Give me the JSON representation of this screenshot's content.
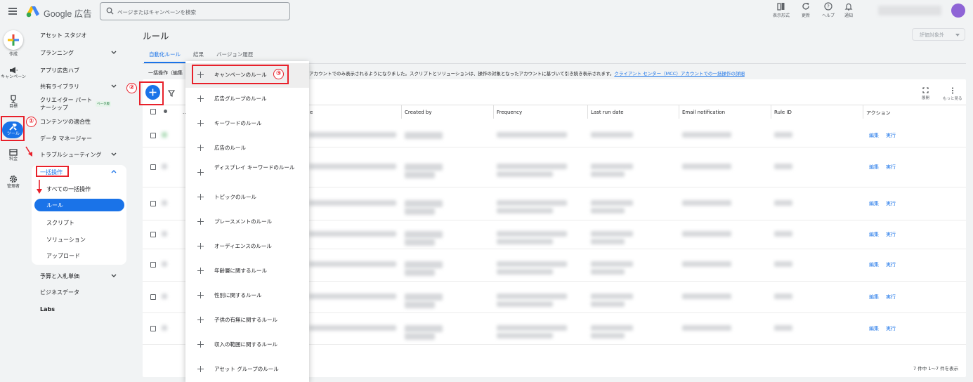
{
  "header": {
    "brand": "Google 広告",
    "search_placeholder": "ページまたはキャンペーンを検索",
    "actions": [
      {
        "name": "view-mode",
        "label": "表示形式",
        "icon": "columns-icon"
      },
      {
        "name": "refresh",
        "label": "更新",
        "icon": "refresh-icon"
      },
      {
        "name": "help",
        "label": "ヘルプ",
        "icon": "help-icon"
      },
      {
        "name": "notifications",
        "label": "通知",
        "icon": "bell-icon"
      }
    ]
  },
  "rail": {
    "items": [
      {
        "label": "作成"
      },
      {
        "label": "キャンペーン"
      },
      {
        "label": "目標"
      },
      {
        "label": "ツール"
      },
      {
        "label": "料金"
      },
      {
        "label": "管理者"
      }
    ]
  },
  "subnav": {
    "items": [
      {
        "label": "アセット スタジオ"
      },
      {
        "label": "プランニング"
      },
      {
        "label": "アプリ広告ハブ"
      },
      {
        "label": "共有ライブラリ"
      },
      {
        "label": "クリエイター パートナーシップ"
      },
      {
        "label": "コンテンツの適合性"
      },
      {
        "label": "データ マネージャー"
      },
      {
        "label": "トラブルシューティング"
      },
      {
        "label": "一括操作"
      },
      {
        "label": "すべての一括操作"
      },
      {
        "label": "ルール"
      },
      {
        "label": "スクリプト"
      },
      {
        "label": "ソリューション"
      },
      {
        "label": "アップロード"
      },
      {
        "label": "予算と入札単価"
      },
      {
        "label": "ビジネスデータ"
      },
      {
        "label": "Labs"
      }
    ],
    "beta_badge": "ベータ版"
  },
  "page": {
    "title": "ルール",
    "filter": "評価対象外",
    "tabs": [
      "自動化ルール",
      "結果",
      "バージョン履歴"
    ],
    "info_left": "一括操作（編集",
    "info_right": "アカウントでのみ表示されるようになりました。スクリプトとソリューションは、操作の対象となったアカウントに基づいて引き続き表示されます。",
    "info_link": "クライアント センター（MCC）アカウントでの一括操作の詳細",
    "toolbar_expand": "展開",
    "toolbar_more": "もっと見る"
  },
  "table": {
    "columns": [
      "Created by",
      "Frequency",
      "Last run date",
      "Email notification",
      "Rule ID",
      "アクション"
    ],
    "col_fragments": [
      "...",
      "e"
    ],
    "rows": [
      {
        "edit": "編集",
        "run": "実行"
      },
      {
        "edit": "編集",
        "run": "実行"
      },
      {
        "edit": "編集",
        "run": "実行"
      },
      {
        "edit": "編集",
        "run": "実行"
      },
      {
        "edit": "編集",
        "run": "実行"
      },
      {
        "edit": "編集",
        "run": "実行"
      },
      {
        "edit": "編集",
        "run": "実行"
      }
    ],
    "pagination": "7 件中 1～7 件を表示"
  },
  "menu": {
    "items": [
      "キャンペーンのルール",
      "広告グループのルール",
      "キーワードのルール",
      "広告のルール",
      "ディスプレイ キーワードのルール",
      "トピックのルール",
      "プレースメントのルール",
      "オーディエンスのルール",
      "年齢層に関するルール",
      "性別に関するルール",
      "子供の有無に関するルール",
      "収入の範囲に関するルール",
      "アセット グループのルール"
    ]
  },
  "annotations": [
    "①",
    "②",
    "③"
  ],
  "colors": {
    "accent": "#1a73e8",
    "annotation": "#e8202a",
    "background": "#f1f3f4"
  }
}
